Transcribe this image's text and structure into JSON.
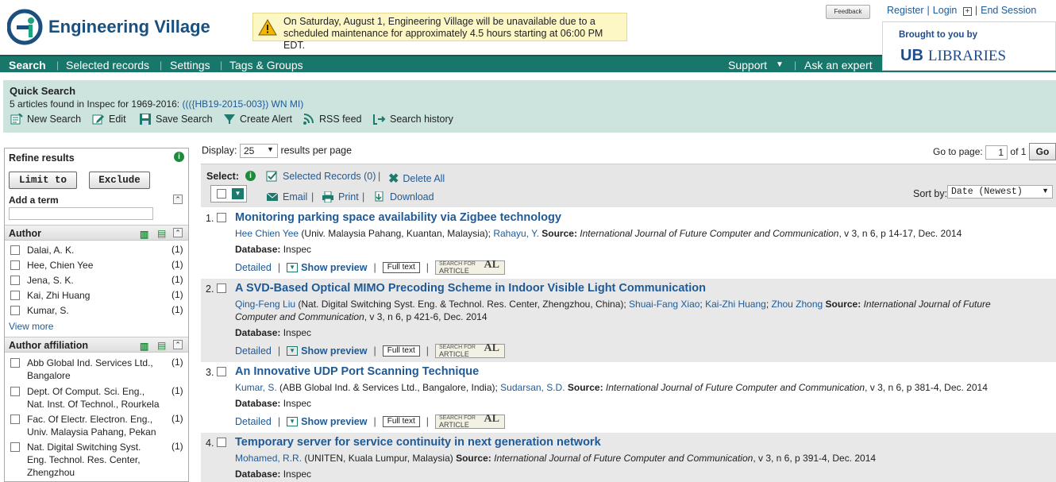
{
  "header": {
    "logo_text": "Engineering Village",
    "notice": "On Saturday, August 1, Engineering Village will be unavailable due to a scheduled maintenance for approximately 4.5 hours starting at 06:00 PM EDT.",
    "feedback_label": "Feedback",
    "top_links": {
      "register": "Register",
      "login": "Login",
      "end_session": "End Session"
    },
    "brought_to_you": "Brought to you by",
    "library_name": "LIBRARIES",
    "library_logo": "UB"
  },
  "nav": {
    "items": [
      "Search",
      "Selected records",
      "Settings",
      "Tags & Groups"
    ],
    "support": "Support",
    "ask_expert": "Ask an expert"
  },
  "quick_search": {
    "title": "Quick Search",
    "summary": "5 articles found in Inspec for 1969-2016:",
    "query": "((({HB19-2015-003}) WN MI)",
    "actions": [
      "New Search",
      "Edit",
      "Save Search",
      "Create Alert",
      "RSS feed",
      "Search history"
    ]
  },
  "sidebar": {
    "title": "Refine results",
    "limit_to": "Limit to",
    "exclude": "Exclude",
    "add_term": "Add a term",
    "author": {
      "title": "Author",
      "items": [
        {
          "label": "Dalai, A. K.",
          "count": "(1)"
        },
        {
          "label": "Hee, Chien Yee",
          "count": "(1)"
        },
        {
          "label": "Jena, S. K.",
          "count": "(1)"
        },
        {
          "label": "Kai, Zhi Huang",
          "count": "(1)"
        },
        {
          "label": "Kumar, S.",
          "count": "(1)"
        }
      ],
      "view_more": "View more"
    },
    "affiliation": {
      "title": "Author affiliation",
      "items": [
        {
          "label": "Abb Global Ind. Services Ltd., Bangalore",
          "count": "(1)"
        },
        {
          "label": "Dept. Of Comput. Sci. Eng., Nat. Inst. Of Technol., Rourkela",
          "count": "(1)"
        },
        {
          "label": "Fac. Of Electr. Electron. Eng., Univ. Malaysia Pahang, Pekan",
          "count": "(1)"
        },
        {
          "label": "Nat. Digital Switching Syst. Eng. Technol. Res. Center, Zhengzhou",
          "count": "(1)"
        }
      ]
    }
  },
  "results_controls": {
    "display_label": "Display:",
    "display_value": "25",
    "per_page": "results per page",
    "goto_label": "Go to page:",
    "page_value": "1",
    "of_label": "of 1",
    "go_label": "Go",
    "select_label": "Select:",
    "selected_records": "Selected Records (0)",
    "delete_all": "Delete All",
    "email": "Email",
    "print": "Print",
    "download": "Download",
    "sort_label": "Sort by:",
    "sort_value": "Date (Newest)"
  },
  "results": [
    {
      "num": "1.",
      "title": "Monitoring parking space availability via Zigbee technology",
      "authors": [
        {
          "name": "Hee Chien Yee",
          "aff": " (Univ. Malaysia Pahang, Kuantan, Malaysia); "
        },
        {
          "name": "Rahayu, Y.",
          "aff": " "
        }
      ],
      "source_label": "Source:",
      "journal": "International Journal of Future Computer and Communication",
      "details": ", v 3, n 6, p 14-17, Dec. 2014",
      "database_label": "Database:",
      "database": "Inspec"
    },
    {
      "num": "2.",
      "title": "A SVD-Based Optical MIMO Precoding Scheme in Indoor Visible Light Communication",
      "authors": [
        {
          "name": "Qing-Feng Liu",
          "aff": " (Nat. Digital Switching Syst. Eng. & Technol. Res. Center, Zhengzhou, China); "
        },
        {
          "name": "Shuai-Fang Xiao",
          "aff": "; "
        },
        {
          "name": "Kai-Zhi Huang",
          "aff": "; "
        },
        {
          "name": "Zhou Zhong",
          "aff": " "
        }
      ],
      "source_label": "Source:",
      "journal": "International Journal of Future Computer and Communication",
      "details": ", v 3, n 6, p 421-6, Dec. 2014",
      "database_label": "Database:",
      "database": "Inspec"
    },
    {
      "num": "3.",
      "title": "An Innovative UDP Port Scanning Technique",
      "authors": [
        {
          "name": "Kumar, S.",
          "aff": " (ABB Global Ind. & Services Ltd., Bangalore, India); "
        },
        {
          "name": "Sudarsan, S.D.",
          "aff": " "
        }
      ],
      "source_label": "Source:",
      "journal": "International Journal of Future Computer and Communication",
      "details": ", v 3, n 6, p 381-4, Dec. 2014",
      "database_label": "Database:",
      "database": "Inspec"
    },
    {
      "num": "4.",
      "title": "Temporary server for service continuity in next generation network",
      "authors": [
        {
          "name": "Mohamed, R.R.",
          "aff": " (UNITEN, Kuala Lumpur, Malaysia) "
        }
      ],
      "source_label": "Source:",
      "journal": "International Journal of Future Computer and Communication",
      "details": ", v 3, n 6, p 391-4, Dec. 2014",
      "database_label": "Database:",
      "database": "Inspec"
    }
  ],
  "result_links": {
    "detailed": "Detailed",
    "preview": "Show preview",
    "fulltext": "Full text",
    "sfa_line1": "SEARCH FOR",
    "sfa_line2": "ARTICLE",
    "sfa_badge": "AL"
  },
  "colors": {
    "nav": "#17776b",
    "quick_search_bg": "#cce4dd",
    "link": "#1f5a97",
    "notice_bg": "#fdf7c6"
  }
}
